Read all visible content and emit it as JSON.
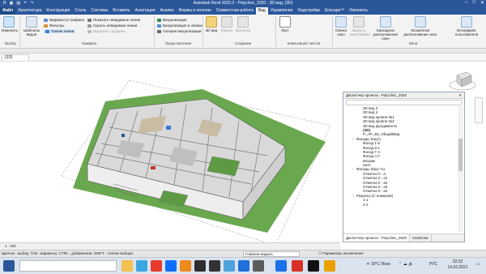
{
  "title": "Autodesk Revit 2020.2 - Polyclinic_2020 - 3D вид: {3D}",
  "tabs": [
    "Файл",
    "Архитектура",
    "Конструкция",
    "Сталь",
    "Системы",
    "Вставить",
    "Аннотации",
    "Анализ",
    "Формы и генплан",
    "Совместная работа",
    "Вид",
    "Управление",
    "Надстройки",
    "Enscape™",
    "Изменить"
  ],
  "ribbon": {
    "modify": "Изменить",
    "templates": "Шаблоны видов",
    "visibility": "Видимость/ графика",
    "filters": "Фильтры",
    "thin_lines": "Тонкие линии",
    "show_hidden": "Показать невидимые линии",
    "hide_hidden": "Скрыть невидимые линии",
    "cut_profile": "Вырезать профиль",
    "render": "Визуализация",
    "render_cloud": "Визуализация в облаке",
    "gallery": "Галерея визуализации",
    "view3d": "3D вид",
    "section": "Разрез",
    "callout": "Выноска",
    "sheet": "Лист",
    "switch": "Смена окон",
    "close_inactive": "Закрыть неактивные",
    "cascade": "Каскадное расположение окон",
    "tile": "Мозаичное расположение окон",
    "ui": "Интерфейс пользователя",
    "groups": [
      "Выбор",
      "Графика",
      "Представление",
      "Создание",
      "Композиция листов",
      "Окна"
    ]
  },
  "view_tab": "{3D}",
  "browser": {
    "title": "Диспетчер проекта - Polyclinic_2020",
    "items": [
      {
        "label": "3D вид 3",
        "indent": 2,
        "toggle": ""
      },
      {
        "label": "3D вид 4",
        "indent": 2,
        "toggle": ""
      },
      {
        "label": "3D вид кровли №1",
        "indent": 2,
        "toggle": ""
      },
      {
        "label": "3D вид кровли №2",
        "indent": 2,
        "toggle": ""
      },
      {
        "label": "3D вид фундамента",
        "indent": 2,
        "toggle": ""
      },
      {
        "label": "{3D}",
        "indent": 2,
        "toggle": "",
        "bold": true
      },
      {
        "label": "P_AP_3D_ОбщийВид",
        "indent": 2,
        "toggle": ""
      },
      {
        "label": "Фасады (Круг)",
        "indent": 1,
        "toggle": "−"
      },
      {
        "label": "Фасад 1-5",
        "indent": 2,
        "toggle": ""
      },
      {
        "label": "Фасад 5-1",
        "indent": 2,
        "toggle": ""
      },
      {
        "label": "Фасад Г-А",
        "indent": 2,
        "toggle": ""
      },
      {
        "label": "Фасад А-Г",
        "indent": 2,
        "toggle": ""
      },
      {
        "label": "витраж",
        "indent": 2,
        "toggle": ""
      },
      {
        "label": "окно",
        "indent": 2,
        "toggle": ""
      },
      {
        "label": "Фасады (Круг %)",
        "indent": 1,
        "toggle": "−"
      },
      {
        "label": "Отметка 0 - а",
        "indent": 2,
        "toggle": ""
      },
      {
        "label": "Отметка 0 - а1",
        "indent": 2,
        "toggle": ""
      },
      {
        "label": "Отметка 0 - а2",
        "indent": 2,
        "toggle": ""
      },
      {
        "label": "Отметка 0 - а3",
        "indent": 2,
        "toggle": ""
      },
      {
        "label": "Отметка 0 - а4",
        "indent": 2,
        "toggle": ""
      },
      {
        "label": "Разрезы (С номером)",
        "indent": 1,
        "toggle": "−"
      },
      {
        "label": "1-1",
        "indent": 2,
        "toggle": ""
      },
      {
        "label": "2-2",
        "indent": 2,
        "toggle": ""
      }
    ],
    "tab_browser": "Диспетчер проекта - Polyclinic_2020",
    "tab_props": "Свойства"
  },
  "scale": "1 : 100",
  "status": {
    "hint": "Щелчок - выбор, TAB - варианты, CTRL - добавление, SHIFT - снятие выбора.",
    "model": "Главная модель",
    "params": "Параметры исключения"
  },
  "tray": {
    "weather": "10°C Ясно",
    "lang": "РУС"
  },
  "clock": {
    "time": "22:32",
    "date": "14.10.2021"
  },
  "colors": {
    "brand": "#2b579a",
    "grass": "#6aa84f",
    "wall": "#e8e8e8"
  }
}
